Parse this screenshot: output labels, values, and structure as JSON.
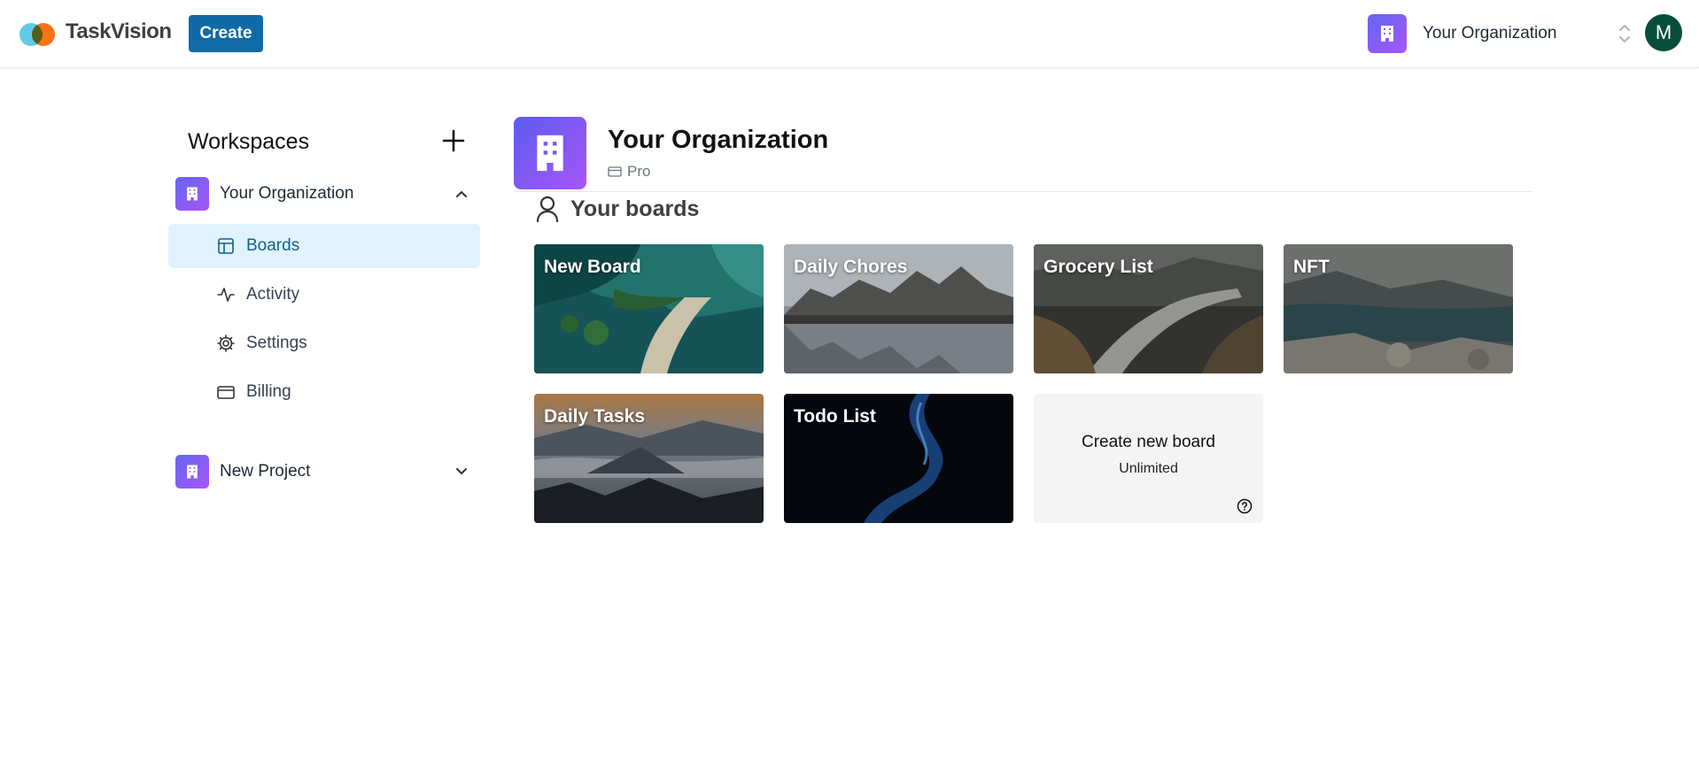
{
  "header": {
    "app_name": "TaskVision",
    "create_label": "Create",
    "org_name": "Your Organization",
    "avatar_initial": "M"
  },
  "sidebar": {
    "title": "Workspaces",
    "orgs": [
      {
        "name": "Your Organization",
        "expanded": true,
        "items": [
          {
            "label": "Boards",
            "icon": "layout-icon",
            "active": true
          },
          {
            "label": "Activity",
            "icon": "activity-icon",
            "active": false
          },
          {
            "label": "Settings",
            "icon": "gear-icon",
            "active": false
          },
          {
            "label": "Billing",
            "icon": "credit-card-icon",
            "active": false
          }
        ]
      },
      {
        "name": "New Project",
        "expanded": false
      }
    ]
  },
  "main": {
    "org_name": "Your Organization",
    "plan": "Pro",
    "boards_heading": "Your boards",
    "boards": [
      {
        "title": "New Board"
      },
      {
        "title": "Daily Chores"
      },
      {
        "title": "Grocery List"
      },
      {
        "title": "NFT"
      },
      {
        "title": "Daily Tasks"
      },
      {
        "title": "Todo List"
      }
    ],
    "create_board": {
      "label": "Create new board",
      "sublabel": "Unlimited"
    }
  },
  "colors": {
    "accent": "#0f6aa5",
    "active_nav_bg": "#e0f2fe",
    "avatar_bg": "#064e3b",
    "org_gradient_start": "#6366f1",
    "org_gradient_end": "#a855f7"
  }
}
